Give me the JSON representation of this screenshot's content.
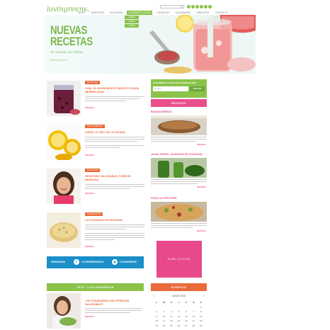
{
  "header": {
    "logo": {
      "text": "lovingreens",
      "accent": "."
    },
    "search_placeholder": "",
    "social_icons": [
      "facebook-icon",
      "twitter-icon",
      "pinterest-icon",
      "instagram-icon",
      "youtube-icon",
      "rss-icon"
    ],
    "nav": [
      "INICIO",
      "NOSOTROS",
      "BLOGGING",
      "COMPARTE LOVING",
      "CONSEJOS",
      "CALENDARIO",
      "SIMILARES",
      "CONTACTO"
    ],
    "nav_active_index": 3,
    "subnav": [
      "NEWS",
      "FORO",
      "SHOP"
    ]
  },
  "hero": {
    "title_line1": "NUEVAS",
    "title_line2": "RECETAS",
    "subtitle": "Al natural sus dietas",
    "signature": "lovingreens"
  },
  "articles": [
    {
      "category": "RECETAS",
      "title": "CHÍA, EL INGREDIENTE PERFECTO PARA MERMELADAS",
      "more": "SEGUIR »",
      "image": "chia-jam-jar"
    },
    {
      "category": "SALUDABLES",
      "title": "LIMÓN: EL REY DE LA COCINA",
      "more": "SEGUIR »",
      "image": "lemons"
    },
    {
      "category": "RECETAS",
      "title": "DESAYUNO SALUDABLE: PURÉ DE MANZANA",
      "more": "SEGUIR »",
      "image": "woman-smiling"
    },
    {
      "category": "ALIMENTOS",
      "title": "LA LEVADURA NUTRICIONAL",
      "more": "SEGUIR »",
      "image": "nutritional-yeast"
    }
  ],
  "newsletter": {
    "title": "SUSCRÍBETE A NUESTRA NEWSLETTER",
    "input_placeholder": "E-mail...",
    "button": "ENVIAR"
  },
  "recetas_header": "RECETAS",
  "recipes": [
    {
      "title": "BANANA BREAD",
      "more": "SEGUIR »",
      "image": "banana-bread"
    },
    {
      "title": "¡AGUA VERDE: UN BATIDO DE VITALIDAD",
      "more": "SEGUIR »",
      "image": "green-smoothie"
    },
    {
      "title": "PIZZA GLUTEN FREE",
      "more": "SEGUIR »",
      "image": "pizza"
    }
  ],
  "ad_label": "PUBLICIDAD",
  "follow": {
    "label": "SÍGUENOS",
    "handles": [
      {
        "icon": "pinterest-icon",
        "text": "LOVINGREENS2013"
      },
      {
        "icon": "instagram-icon",
        "text": "LOVINGREENS"
      }
    ]
  },
  "test": {
    "header": "TEST LOVINGREENS",
    "title": "¿TE CONSIDERAS UNA PERSONA SALUDABLE?",
    "more": "SEGUIR »"
  },
  "events": {
    "header": "EVENTOS",
    "month": "JUNIO 2015",
    "weekdays": [
      "L",
      "M",
      "X",
      "J",
      "V",
      "S",
      "D"
    ],
    "days": [
      "",
      "",
      "",
      "",
      "",
      "",
      "1",
      "2",
      "3",
      "4",
      "5",
      "6",
      "7",
      "8",
      "9",
      "10",
      "11",
      "12",
      "13",
      "14",
      "15",
      "16",
      "17",
      "18",
      "19",
      "20",
      "21",
      "22",
      "23",
      "24",
      "25",
      "26",
      "27",
      "28",
      "29"
    ]
  },
  "colors": {
    "green": "#8bc34a",
    "orange": "#ea6a3a",
    "pink": "#e9508a",
    "blue": "#1a8fc8"
  }
}
